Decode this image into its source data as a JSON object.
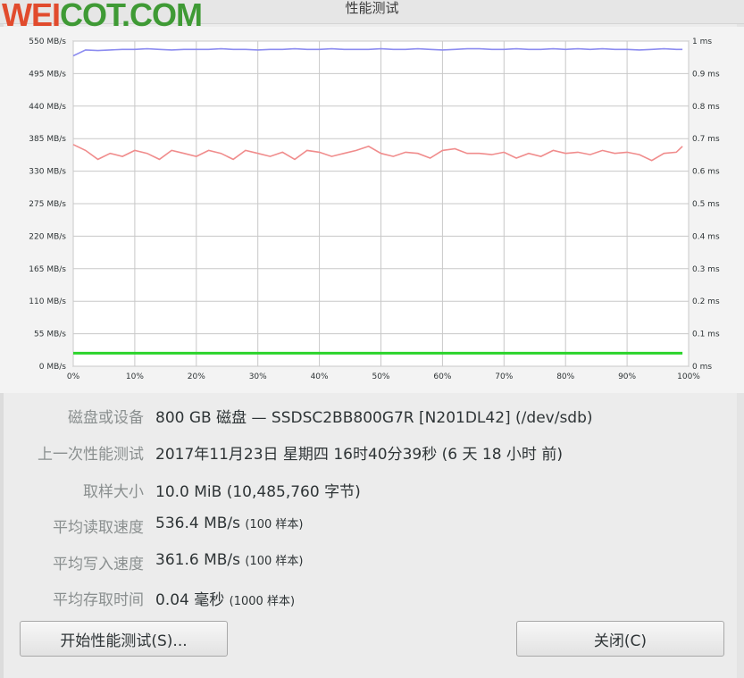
{
  "watermark": {
    "part1": "WEI",
    "part2": "COT.COM"
  },
  "window": {
    "title": "性能测试"
  },
  "chart_data": {
    "type": "line",
    "x": [
      0,
      2,
      4,
      6,
      8,
      10,
      12,
      14,
      16,
      18,
      20,
      22,
      24,
      26,
      28,
      30,
      32,
      34,
      36,
      38,
      40,
      42,
      44,
      46,
      48,
      50,
      52,
      54,
      56,
      58,
      60,
      62,
      64,
      66,
      68,
      70,
      72,
      74,
      76,
      78,
      80,
      82,
      84,
      86,
      88,
      90,
      92,
      94,
      96,
      98,
      99
    ],
    "xlim": [
      0,
      100
    ],
    "xticks": [
      "0%",
      "10%",
      "20%",
      "30%",
      "40%",
      "50%",
      "60%",
      "70%",
      "80%",
      "90%",
      "100%"
    ],
    "ylim_left": [
      0,
      550
    ],
    "yticks_left": [
      "0 MB/s",
      "55 MB/s",
      "110 MB/s",
      "165 MB/s",
      "220 MB/s",
      "275 MB/s",
      "330 MB/s",
      "385 MB/s",
      "440 MB/s",
      "495 MB/s",
      "550 MB/s"
    ],
    "ylim_right": [
      0,
      1
    ],
    "yticks_right": [
      "0 ms",
      "0.1 ms",
      "0.2 ms",
      "0.3 ms",
      "0.4 ms",
      "0.5 ms",
      "0.6 ms",
      "0.7 ms",
      "0.8 ms",
      "0.9 ms",
      "1 ms"
    ],
    "grid": true,
    "series": [
      {
        "axis": "left",
        "color": "#8c8cf0",
        "values": [
          525,
          535,
          534,
          535,
          536,
          536,
          537,
          536,
          535,
          536,
          536,
          536,
          537,
          536,
          536,
          535,
          536,
          536,
          537,
          536,
          536,
          537,
          536,
          536,
          536,
          537,
          536,
          536,
          537,
          536,
          535,
          536,
          537,
          537,
          536,
          536,
          537,
          536,
          536,
          537,
          536,
          537,
          536,
          537,
          536,
          536,
          535,
          536,
          537,
          536,
          536
        ]
      },
      {
        "axis": "left",
        "color": "#f08c8c",
        "values": [
          375,
          365,
          350,
          360,
          355,
          365,
          360,
          350,
          365,
          360,
          355,
          365,
          360,
          350,
          365,
          360,
          355,
          362,
          350,
          365,
          362,
          355,
          360,
          365,
          372,
          360,
          355,
          362,
          360,
          352,
          365,
          368,
          360,
          360,
          358,
          362,
          352,
          360,
          355,
          365,
          360,
          362,
          358,
          365,
          360,
          362,
          358,
          348,
          360,
          362,
          372
        ]
      },
      {
        "axis": "right",
        "color": "#2bd42b",
        "values": [
          0.04,
          0.04,
          0.04,
          0.04,
          0.04,
          0.04,
          0.04,
          0.04,
          0.04,
          0.04,
          0.04,
          0.04,
          0.04,
          0.04,
          0.04,
          0.04,
          0.04,
          0.04,
          0.04,
          0.04,
          0.04,
          0.04,
          0.04,
          0.04,
          0.04,
          0.04,
          0.04,
          0.04,
          0.04,
          0.04,
          0.04,
          0.04,
          0.04,
          0.04,
          0.04,
          0.04,
          0.04,
          0.04,
          0.04,
          0.04,
          0.04,
          0.04,
          0.04,
          0.04,
          0.04,
          0.04,
          0.04,
          0.04,
          0.04,
          0.04,
          0.04
        ]
      }
    ]
  },
  "info": {
    "device_label": "磁盘或设备",
    "device_value": "800 GB 磁盘 — SSDSC2BB800G7R [N201DL42] (/dev/sdb)",
    "last_label": "上一次性能测试",
    "last_value": "2017年11月23日 星期四 16时40分39秒 (6 天 18 小时 前)",
    "sample_label": "取样大小",
    "sample_value": "10.0 MiB (10,485,760 字节)",
    "read_label": "平均读取速度",
    "read_value": "536.4 MB/s",
    "read_note": "(100 样本)",
    "write_label": "平均写入速度",
    "write_value": "361.6 MB/s",
    "write_note": "(100 样本)",
    "access_label": "平均存取时间",
    "access_value": "0.04 毫秒",
    "access_note": "(1000 样本)"
  },
  "buttons": {
    "start": "开始性能测试(S)...",
    "close": "关闭(C)"
  }
}
